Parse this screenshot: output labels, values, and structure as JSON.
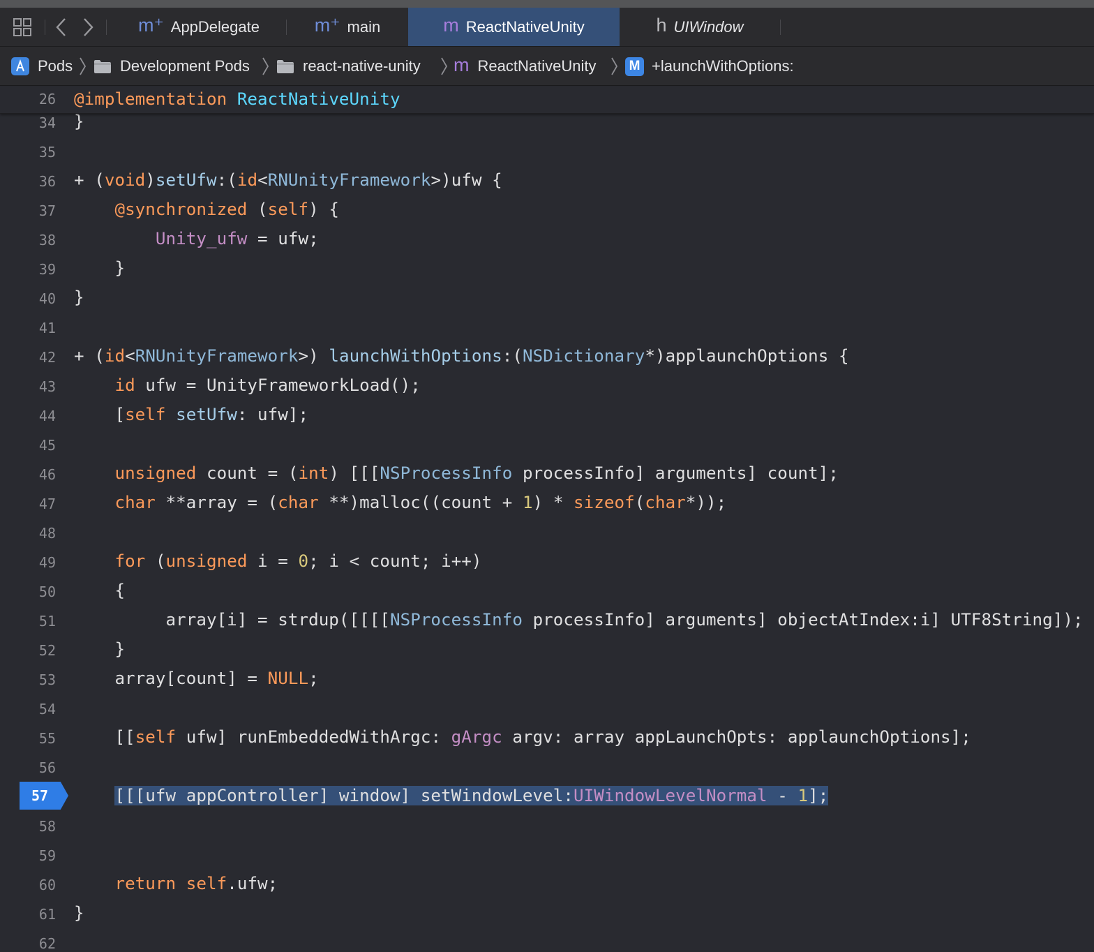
{
  "tabs": [
    {
      "icon": "m⁺",
      "label": "AppDelegate"
    },
    {
      "icon": "m⁺",
      "label": "main"
    },
    {
      "icon": "m",
      "label": "ReactNativeUnity"
    },
    {
      "icon": "h",
      "label": "UIWindow"
    }
  ],
  "breadcrumb": [
    {
      "label": "Pods",
      "icon": "app-icon"
    },
    {
      "label": "Development Pods",
      "icon": "folder-icon"
    },
    {
      "label": "react-native-unity",
      "icon": "folder-icon"
    },
    {
      "label": "ReactNativeUnity",
      "icon": "m"
    },
    {
      "label": "+launchWithOptions:",
      "icon": "M"
    }
  ],
  "sticky": {
    "line": "26",
    "keyword": "@implementation",
    "name": "ReactNativeUnity"
  },
  "breakpoint_line": "57",
  "lines": [
    {
      "n": "34",
      "t": "}"
    },
    {
      "n": "35",
      "t": ""
    },
    {
      "n": "36",
      "t": "+ (void)setUfw:(id<RNUnityFramework>)ufw {"
    },
    {
      "n": "37",
      "t": "    @synchronized (self) {"
    },
    {
      "n": "38",
      "t": "        Unity_ufw = ufw;"
    },
    {
      "n": "39",
      "t": "    }"
    },
    {
      "n": "40",
      "t": "}"
    },
    {
      "n": "41",
      "t": ""
    },
    {
      "n": "42",
      "t": "+ (id<RNUnityFramework>) launchWithOptions:(NSDictionary*)applaunchOptions {"
    },
    {
      "n": "43",
      "t": "    id ufw = UnityFrameworkLoad();"
    },
    {
      "n": "44",
      "t": "    [self setUfw: ufw];"
    },
    {
      "n": "45",
      "t": ""
    },
    {
      "n": "46",
      "t": "    unsigned count = (int) [[[NSProcessInfo processInfo] arguments] count];"
    },
    {
      "n": "47",
      "t": "    char **array = (char **)malloc((count + 1) * sizeof(char*));"
    },
    {
      "n": "48",
      "t": ""
    },
    {
      "n": "49",
      "t": "    for (unsigned i = 0; i < count; i++)"
    },
    {
      "n": "50",
      "t": "    {"
    },
    {
      "n": "51",
      "t": "         array[i] = strdup([[[[NSProcessInfo processInfo] arguments] objectAtIndex:i] UTF8String]);"
    },
    {
      "n": "52",
      "t": "    }"
    },
    {
      "n": "53",
      "t": "    array[count] = NULL;"
    },
    {
      "n": "54",
      "t": ""
    },
    {
      "n": "55",
      "t": "    [[self ufw] runEmbeddedWithArgc: gArgc argv: array appLaunchOpts: applaunchOptions];"
    },
    {
      "n": "56",
      "t": ""
    },
    {
      "n": "57",
      "t": "    [[[ufw appController] window] setWindowLevel:UIWindowLevelNormal - 1];"
    },
    {
      "n": "58",
      "t": ""
    },
    {
      "n": "59",
      "t": ""
    },
    {
      "n": "60",
      "t": "    return self.ufw;"
    },
    {
      "n": "61",
      "t": "}"
    },
    {
      "n": "62",
      "t": ""
    }
  ]
}
